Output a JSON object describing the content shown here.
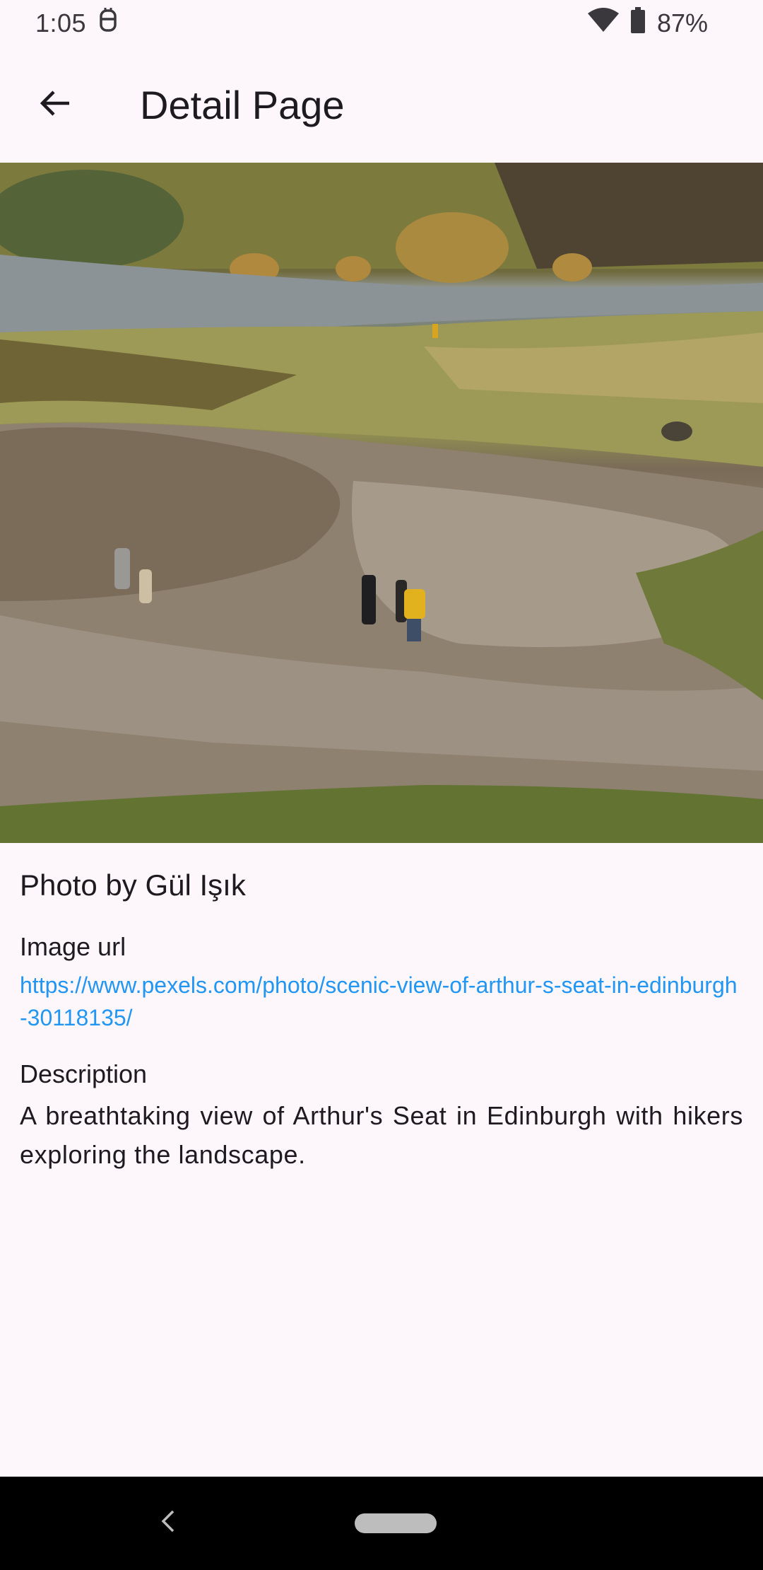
{
  "status_bar": {
    "time": "1:05",
    "battery_percent": "87%",
    "icons": [
      "notification-app-icon",
      "wifi-icon",
      "battery-icon"
    ]
  },
  "app_bar": {
    "title": "Detail Page",
    "back_icon": "arrow-left-icon"
  },
  "photo": {
    "photographer_line": "Photo by Gül Işık",
    "image_url_label": "Image url",
    "image_url": "https://www.pexels.com/photo/scenic-view-of-arthur-s-seat-in-edinburgh-30118135/",
    "description_label": "Description",
    "description": "A breathtaking view of Arthur's Seat in Edinburgh with hikers exploring the landscape."
  },
  "nav_bar": {
    "back_icon": "chevron-left-icon",
    "home_icon": "home-pill-icon"
  },
  "colors": {
    "background": "#fdf7fc",
    "link": "#2196f3",
    "text": "#1d1b20",
    "nav_bar": "#000000"
  }
}
